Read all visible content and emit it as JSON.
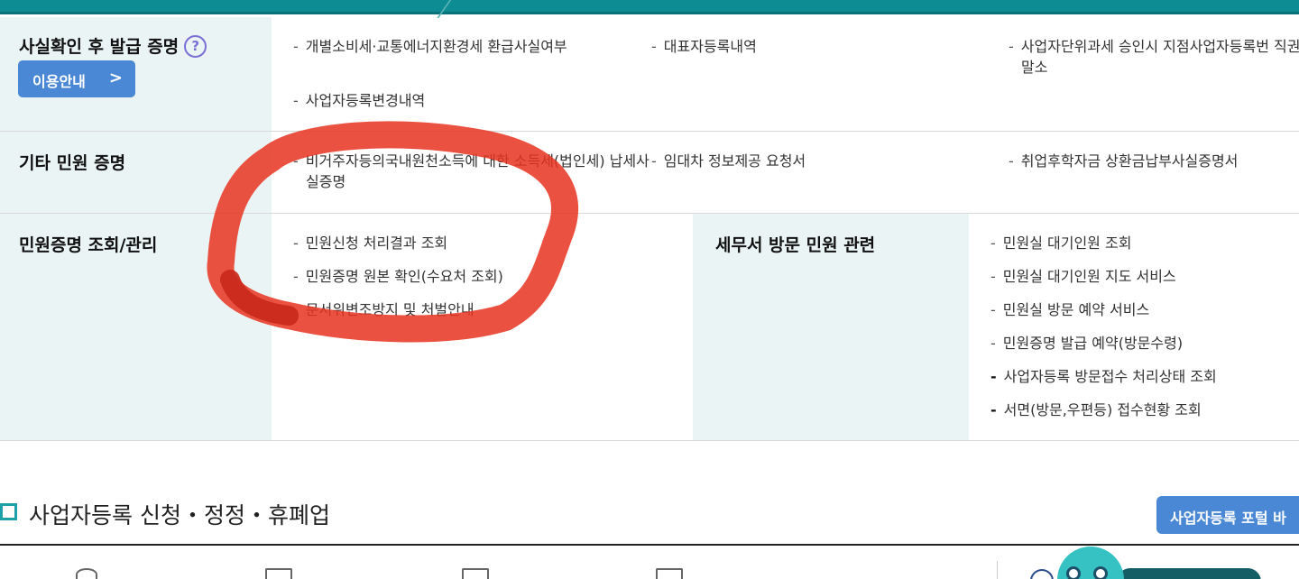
{
  "row1": {
    "title": "사실확인 후 발급 증명",
    "help_icon": "question-circle-icon",
    "guide_button": "이용안내",
    "items": [
      "개별소비세·교통에너지환경세 환급사실여부",
      "대표자등록내역",
      "사업자단위과세 승인시 지점사업자등록번 직권말소",
      "사업자등록변경내역"
    ]
  },
  "row2": {
    "title": "기타 민원 증명",
    "items": [
      "비거주자등의국내원천소득에 대한 소득세(법인세) 납세사실증명",
      "임대차 정보제공 요청서",
      "취업후학자금 상환금납부사실증명서"
    ]
  },
  "row3": {
    "title": "민원증명 조회/관리",
    "items": [
      "민원신청 처리결과 조회",
      "민원증명 원본 확인(수요처 조회)",
      "문서위변조방지 및 처벌안내"
    ],
    "right_title": "세무서 방문 민원 관련",
    "right_items": [
      "민원실 대기인원 조회",
      "민원실 대기인원 지도 서비스",
      "민원실 방문 예약 서비스",
      "민원증명 발급 예약(방문수령)",
      "사업자등록 방문접수 처리상태 조회",
      "서면(방문,우편등) 접수현황 조회"
    ]
  },
  "section": {
    "title": "사업자등록 신청・정정・휴폐업",
    "portal_button": "사업자등록 포털 바"
  },
  "colors": {
    "topbar": "#0e8c93",
    "header_cell": "#eaf4f5",
    "button": "#4a87d4",
    "annotation": "#e8321e"
  }
}
